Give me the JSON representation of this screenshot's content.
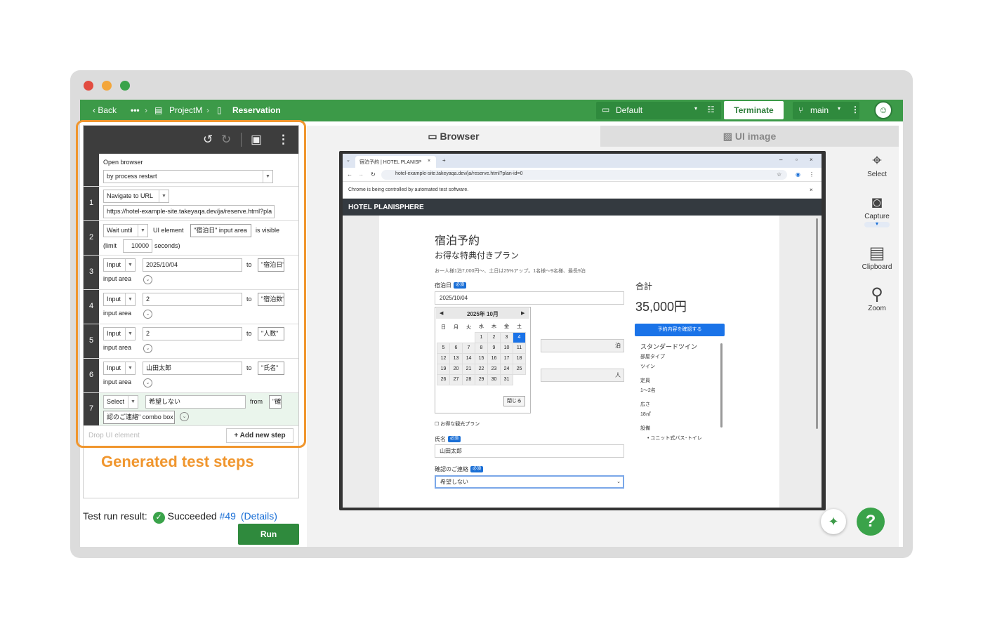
{
  "topbar": {
    "back": "Back",
    "more": "•••",
    "project": "ProjectM",
    "page": "Reservation",
    "env": "Default",
    "terminate": "Terminate",
    "branch": "main"
  },
  "steps": {
    "open_browser": "Open browser",
    "open_mode": "by process restart",
    "s1": {
      "num": "1",
      "action": "Navigate to URL",
      "url": "https://hotel-example-site.takeyaqa.dev/ja/reserve.html?pla"
    },
    "s2": {
      "num": "2",
      "action": "Wait until",
      "ui_element": "UI element",
      "target": "\"宿泊日\" input area",
      "cond": "is visible",
      "limit": "(limit",
      "limit_val": "10000",
      "seconds": "seconds)"
    },
    "s3": {
      "num": "3",
      "action": "Input",
      "value": "2025/10/04",
      "to": "to",
      "target": "\"宿泊日\"",
      "target2": "input area"
    },
    "s4": {
      "num": "4",
      "action": "Input",
      "value": "2",
      "to": "to",
      "target": "\"宿泊数\"",
      "target2": "input area"
    },
    "s5": {
      "num": "5",
      "action": "Input",
      "value": "2",
      "to": "to",
      "target": "\"人数\"",
      "target2": "input area"
    },
    "s6": {
      "num": "6",
      "action": "Input",
      "value": "山田太郎",
      "to": "to",
      "target": "\"氏名\"",
      "target2": "input area"
    },
    "s7": {
      "num": "7",
      "action": "Select",
      "value": "希望しない",
      "from": "from",
      "target": "\"確",
      "target2": "認のご連絡\" combo box"
    },
    "drop": "Drop UI element",
    "add": "Add new step"
  },
  "annotation": "Generated test steps",
  "result": {
    "label": "Test run result:",
    "status": "Succeeded",
    "run": "#49",
    "details": "(Details)"
  },
  "run_button": "Run",
  "tabs": {
    "browser": "Browser",
    "ui_image": "UI image"
  },
  "tools": {
    "select": "Select",
    "capture": "Capture",
    "clipboard": "Clipboard",
    "zoom": "Zoom"
  },
  "browser": {
    "tab_title": "宿泊予約 | HOTEL PLANISP",
    "url": "hotel-example-site.takeyaqa.dev/ja/reserve.html?plan-id=0",
    "banner": "Chrome is being controlled by automated test software.",
    "site": "HOTEL PLANISPHERE",
    "h1": "宿泊予約",
    "h2": "お得な特典付きプラン",
    "desc": "お一人様1泊7,000円〜、土日は25%アップ。1名様〜9名様、最長9泊",
    "date_label": "宿泊日",
    "required": "必須",
    "date_value": "2025/10/04",
    "cal_title": "2025年 10月",
    "cal_days": [
      "日",
      "月",
      "火",
      "水",
      "木",
      "金",
      "土"
    ],
    "cal_rows": [
      [
        "",
        "",
        "",
        "1",
        "2",
        "3",
        "4"
      ],
      [
        "5",
        "6",
        "7",
        "8",
        "9",
        "10",
        "11"
      ],
      [
        "12",
        "13",
        "14",
        "15",
        "16",
        "17",
        "18"
      ],
      [
        "19",
        "20",
        "21",
        "22",
        "23",
        "24",
        "25"
      ],
      [
        "26",
        "27",
        "28",
        "29",
        "30",
        "31",
        ""
      ]
    ],
    "cal_close": "閉じる",
    "nights_unit": "泊",
    "people_unit": "人",
    "sightseeing": "お得な観光プラン",
    "name_label": "氏名",
    "name_value": "山田太郎",
    "contact_label": "確認のご連絡",
    "contact_value": "希望しない",
    "total_label": "合計",
    "total": "35,000円",
    "confirm": "予約内容を確認する",
    "room": "スタンダードツイン",
    "room_type_l": "部屋タイプ",
    "room_type": "ツイン",
    "cap_l": "定員",
    "cap": "1〜2名",
    "size_l": "広さ",
    "size": "18㎡",
    "equip_l": "設備",
    "equip": "ユニット式バス･トイレ"
  },
  "colors": {
    "green": "#3c9a48",
    "orange": "#f0962e",
    "blue": "#1a6fd6"
  }
}
